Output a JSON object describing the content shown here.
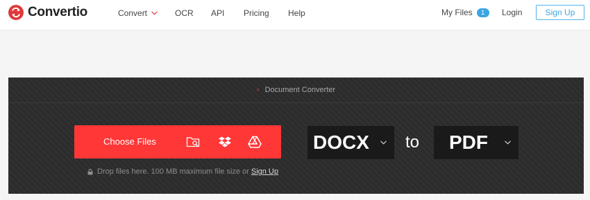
{
  "brand": {
    "name": "Convertio",
    "color": "#e0393b"
  },
  "nav": {
    "convert": "Convert",
    "ocr": "OCR",
    "api": "API",
    "pricing": "Pricing",
    "help": "Help"
  },
  "account": {
    "my_files": "My Files",
    "files_count": "1",
    "login": "Login",
    "signup": "Sign Up"
  },
  "converter": {
    "breadcrumb": "Document Converter",
    "choose_files": "Choose Files",
    "source_icons": [
      "folder-search-icon",
      "dropbox-icon",
      "google-drive-icon"
    ],
    "drop_hint": "Drop files here. 100 MB maximum file size or",
    "drop_hint_link": "Sign Up",
    "from_format": "DOCX",
    "to_word": "to",
    "to_format": "PDF"
  },
  "colors": {
    "accent": "#ff3737",
    "link": "#3aa6e3",
    "panel": "#2c2c2c",
    "format_box": "#1a1a1a"
  }
}
